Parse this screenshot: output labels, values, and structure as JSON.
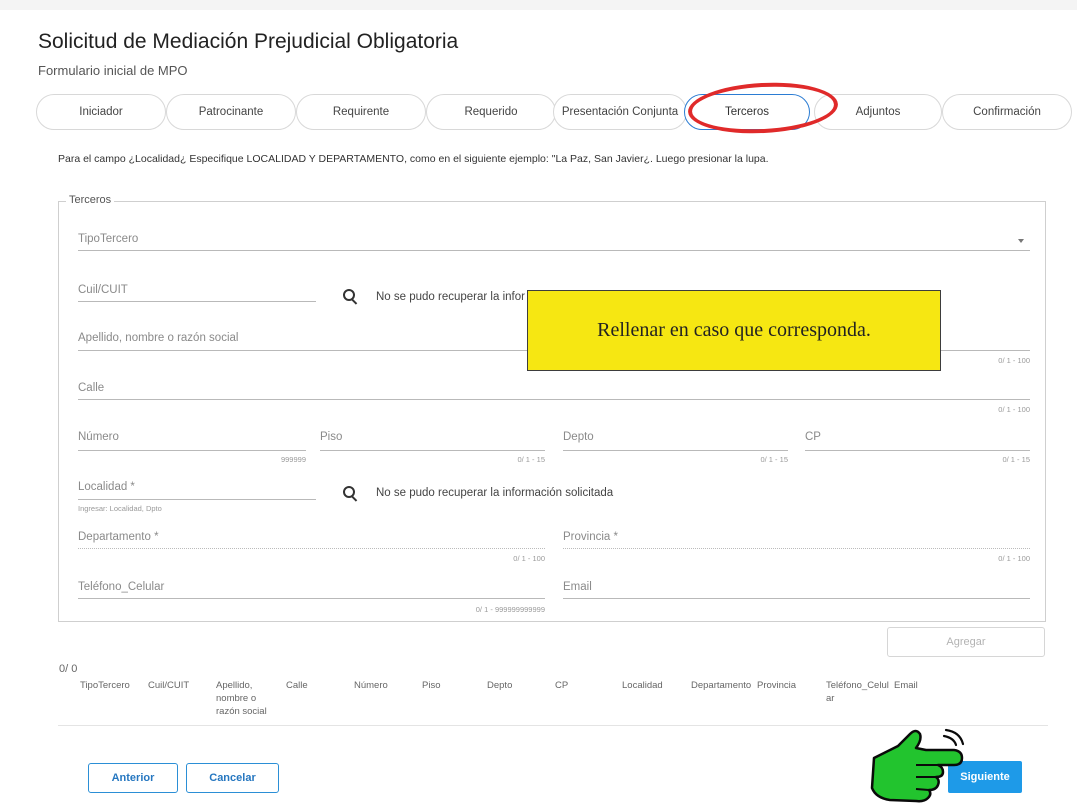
{
  "header": {
    "title": "Solicitud de Mediación Prejudicial Obligatoria",
    "subtitle": "Formulario inicial de MPO"
  },
  "tabs": [
    {
      "label": "Iniciador"
    },
    {
      "label": "Patrocinante"
    },
    {
      "label": "Requirente"
    },
    {
      "label": "Requerido"
    },
    {
      "label": "Presentación Conjunta"
    },
    {
      "label": "Terceros"
    },
    {
      "label": "Adjuntos"
    },
    {
      "label": "Confirmación"
    }
  ],
  "active_tab": "Terceros",
  "instructions": "Para el campo ¿Localidad¿ Especifique LOCALIDAD Y DEPARTAMENTO, como en el siguiente ejemplo: \"La Paz, San Javier¿. Luego presionar la lupa.",
  "form": {
    "legend": "Terceros",
    "tipo_tercero": "TipoTercero",
    "cuil": "Cuil/CUIT",
    "cuil_message": "No se pudo recuperar la infor",
    "apellido": "Apellido, nombre o razón social",
    "apellido_counter": "0/ 1 - 100",
    "calle": "Calle",
    "calle_counter": "0/ 1 - 100",
    "numero": "Número",
    "numero_counter": "999999",
    "piso": "Piso",
    "piso_counter": "0/ 1 - 15",
    "depto": "Depto",
    "depto_counter": "0/ 1 - 15",
    "cp": "CP",
    "cp_counter": "0/ 1 - 15",
    "localidad": "Localidad *",
    "localidad_hint": "Ingresar: Localidad, Dpto",
    "localidad_message": "No se pudo recuperar la información solicitada",
    "departamento": "Departamento *",
    "departamento_counter": "0/ 1 - 100",
    "provincia": "Provincia *",
    "provincia_counter": "0/ 1 - 100",
    "telefono": "Teléfono_Celular",
    "telefono_counter": "0/ 1 - 999999999999",
    "email": "Email"
  },
  "callout": "Rellenar en caso que corresponda.",
  "agregar_label": "Agregar",
  "table": {
    "count": "0/ 0",
    "headers": [
      "TipoTercero",
      "Cuil/CUIT",
      "Apellido,\nnombre o\nrazón social",
      "Calle",
      "Número",
      "Piso",
      "Depto",
      "CP",
      "Localidad",
      "Departamento",
      "Provincia",
      "Teléfono_Celul\nar",
      "Email"
    ]
  },
  "buttons": {
    "anterior": "Anterior",
    "cancelar": "Cancelar",
    "siguiente": "Siguiente"
  },
  "colors": {
    "accent": "#1e9ae8",
    "highlight_circle": "#e02a2a",
    "callout_bg": "#f6e712",
    "hand": "#22c42e"
  },
  "icons": {
    "search": "search-icon",
    "dropdown": "caret-down-icon",
    "pointer": "pointing-hand-icon"
  }
}
